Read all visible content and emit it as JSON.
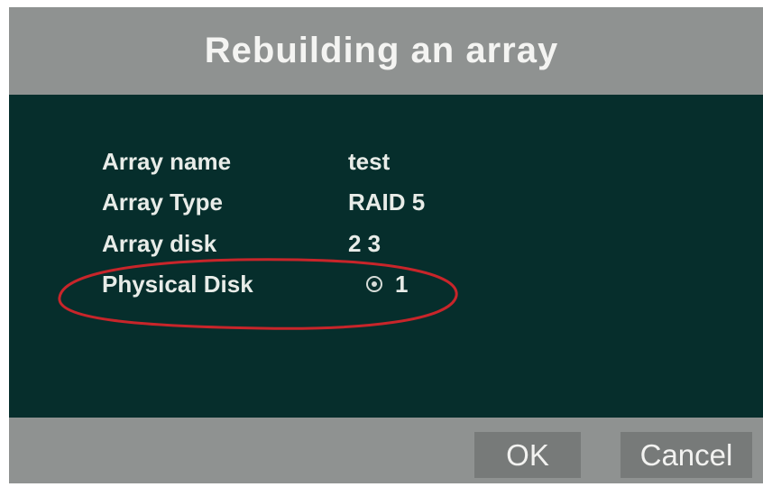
{
  "dialog": {
    "title": "Rebuilding an array",
    "fields": [
      {
        "label": "Array name",
        "value": "test"
      },
      {
        "label": "Array Type",
        "value": "RAID 5"
      },
      {
        "label": "Array disk",
        "value": "2 3"
      },
      {
        "label": "Physical Disk",
        "value": "1",
        "selected": true
      }
    ],
    "buttons": {
      "ok": "OK",
      "cancel": "Cancel"
    }
  },
  "colors": {
    "dialog_chrome": "#8f9291",
    "content_bg": "#062e2c",
    "button_bg": "#777a79",
    "annotation_circle": "#c8252a"
  },
  "icons": {
    "physical_disk_option": "radio-selected-icon"
  }
}
